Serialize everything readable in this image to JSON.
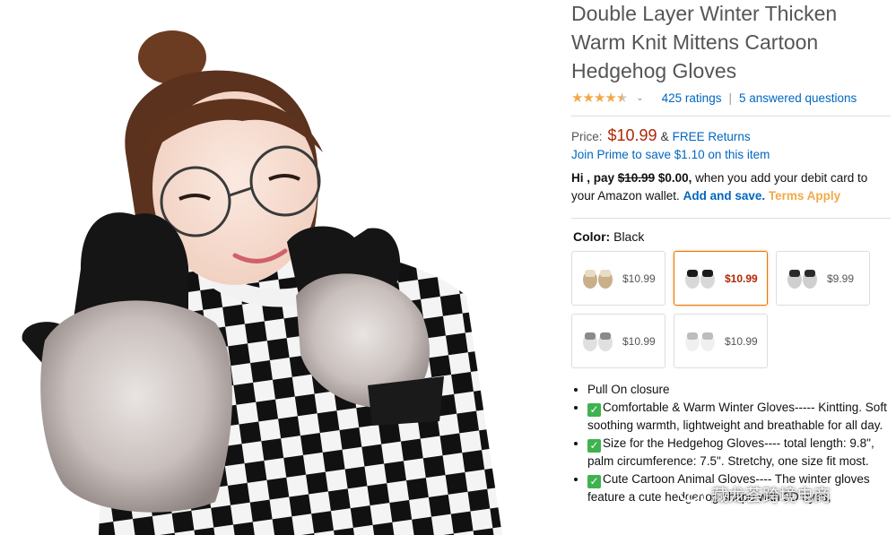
{
  "product": {
    "title": "Double Layer Winter Thicken Warm Knit Mittens Cartoon Hedgehog Gloves",
    "rating": 4.5,
    "ratings_count": "425 ratings",
    "answered_questions": "5 answered questions",
    "price_label": "Price:",
    "price": "$10.99",
    "amp": "&",
    "free_returns": "FREE Returns",
    "prime_text": "Join Prime to save $1.10 on this item"
  },
  "promo": {
    "hi": "Hi , pay",
    "old_price": "$10.99",
    "new_price": "$0.00,",
    "rest": "when you add your debit card to your Amazon wallet.",
    "add_save": "Add and save.",
    "terms": "Terms Apply"
  },
  "color": {
    "label": "Color:",
    "value": "Black",
    "swatches": [
      {
        "price": "$10.99",
        "colors": [
          "#e8dcc4",
          "#c9b08a"
        ],
        "selected": false
      },
      {
        "price": "$10.99",
        "colors": [
          "#1a1a1a",
          "#d8d8d8"
        ],
        "selected": true
      },
      {
        "price": "$9.99",
        "colors": [
          "#2a2a2a",
          "#cfcfcf"
        ],
        "selected": false
      },
      {
        "price": "$10.99",
        "colors": [
          "#8a8a8a",
          "#e0e0e0"
        ],
        "selected": false
      },
      {
        "price": "$10.99",
        "colors": [
          "#bdbdbd",
          "#f0f0f0"
        ],
        "selected": false
      }
    ]
  },
  "bullets": [
    {
      "check": false,
      "text": "Pull On closure"
    },
    {
      "check": true,
      "text": "Comfortable & Warm Winter Gloves----- Kintting. Soft soothing warmth, lightweight and breathable for all day."
    },
    {
      "check": true,
      "text": "Size for the Hedgehog Gloves---- total length: 9.8\", palm circumference: 7.5\". Stretchy, one size fit most."
    },
    {
      "check": true,
      "text": "Cute Cartoon Animal Gloves---- The winter gloves feature a cute hedgehog shape with 3D eyes,"
    }
  ],
  "watermark": "藏龙荟跨境电商",
  "colors": {
    "link": "#0066c0",
    "price": "#b12704",
    "star": "#f3a847",
    "selected_border": "#e77600",
    "terms": "#f3a847"
  },
  "icons": {
    "star": "star-icon",
    "caret": "chevron-down-icon",
    "check": "checkmark-icon",
    "wechat": "wechat-icon"
  }
}
